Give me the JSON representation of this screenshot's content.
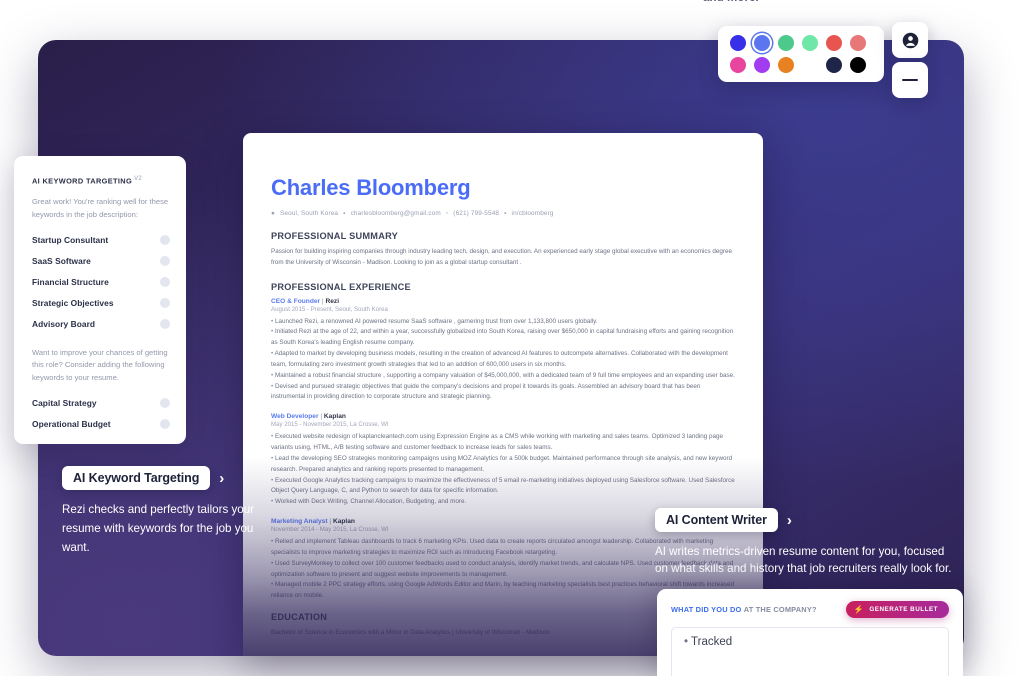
{
  "top_cut_text": "and more.",
  "keyword_panel": {
    "title": "AI KEYWORD TARGETING",
    "version": "v2",
    "description": "Great work! You're ranking well for these keywords in the job description:",
    "matched_keywords": [
      "Startup Consultant",
      "SaaS Software",
      "Financial Structure",
      "Strategic Objectives",
      "Advisory Board"
    ],
    "suggestion_text": "Want to improve your chances of getting this role? Consider adding the following keywords to your resume.",
    "suggested_keywords": [
      "Capital Strategy",
      "Operational Budget"
    ]
  },
  "callouts": [
    {
      "label": "AI Keyword Targeting",
      "chevron": "›",
      "text": "Rezi checks and perfectly tailors your resume with keywords for the job you want."
    },
    {
      "label": "AI Content Writer",
      "chevron": "›",
      "text": "AI writes metrics-driven resume content for you, focused on what skills and history that job recruiters really look for."
    }
  ],
  "resume": {
    "name": "Charles Bloomberg",
    "contact": {
      "location_icon": "pin-icon",
      "location": "Seoul, South Korea",
      "email_icon": "envelope-icon",
      "email": "charlesbloomberg@gmail.com",
      "phone_icon": "phone-icon",
      "phone": "(621) 799-5548",
      "linkedin_icon": "linkedin-icon",
      "linkedin": "in/cbloomberg"
    },
    "sections": [
      {
        "heading": "PROFESSIONAL SUMMARY",
        "paragraph": "Passion for building inspiring companies through industry leading tech, design, and execution. An experienced early stage global executive with an economics degree from the University of Wisconsin - Madison. Looking to join as a global  startup consultant ."
      }
    ],
    "experience_heading": "PROFESSIONAL EXPERIENCE",
    "jobs": [
      {
        "role": "CEO & Founder",
        "separator": "|",
        "company": "Rezi",
        "dates": "August 2015 - Present, Seoul, South Korea",
        "bullets": [
          "Launched Rezi, a renowned AI powered resume  SaaS software , garnering trust from over 1,133,800 users globally.",
          "Initiated Rezi at the age of 22, and within a year, successfully globalized into South Korea, raising over $650,000 in capital fundraising efforts and gaining recognition as South Korea's leading English resume company.",
          "Adapted to market by developing business models, resulting in the creation of advanced AI features to outcompete alternatives. Collaborated with the development team, formulating zero investment growth strategies that led to an addition of 600,000 users in six months.",
          "Maintained a robust  financial structure , supporting a company valuation of $45,000,000, with a dedicated team of 9 full time employees and an expanding user base.",
          "Devised and pursued  strategic objectives  that guide the company's decisions and propel it towards its goals. Assembled an  advisory board  that has been instrumental in providing direction to corporate structure and strategic planning."
        ]
      },
      {
        "role": "Web Developer",
        "separator": "|",
        "company": "Kaplan",
        "dates": "May 2015 - November 2015, La Crosse, WI",
        "bullets": [
          "Executed website redesign of kaplancleantech.com using Expression Engine as a CMS while working with marketing and sales teams. Optimized 3 landing page variants using, HTML, A/B testing software and customer feedback to increase leads for sales teams.",
          "Lead the developing SEO strategies monitoring campaigns using MOZ Analytics for a 500k budget. Maintained performance through site analysis, and new keyword research. Prepared analytics and ranking reports presented to management.",
          "Executed Google Analytics tracking campaigns to maximize the effectiveness of 5 email re-marketing initiatives deployed using Salesforce software. Used Salesforce Object Query Language, C, and Python to search for data for specific information.",
          "Worked with Deck Writing, Channel Allocation, Budgeting, and more."
        ]
      },
      {
        "role": "Marketing Analyst",
        "separator": "|",
        "company": "Kaplan",
        "dates": "November 2014 - May 2015, La Crosse, WI",
        "bullets": [
          "Relied and implement Tableau dashboards to track 6 marketing KPIs. Used data to create reports circulated amongst leadership. Collaborated with marketing specialists to improve marketing strategies to maximize ROI such as introducing Facebook retargeting.",
          "Used SurveyMonkey to collect over 100 customer feedbacks used to conduct analysis, identify market trends, and calculate NPS. Used customer feedback data and optimization software to present and suggest website improvements to management.",
          "Managed mobile 2 PPC strategy efforts, using Google AdWords Editor and Marin, by teaching marketing specialists best practices behavioral shift towards increased reliance on mobile."
        ]
      }
    ],
    "education_heading": "EDUCATION",
    "education_line": "Bachelor of Science in Economics with a Minor in Data Analytics | University of Wisconsin - Madison"
  },
  "bullet_editor": {
    "question_bold": "WHAT DID YOU DO",
    "question_rest": "AT THE COMPANY?",
    "generate_label": "GENERATE BULLET",
    "generate_icon": "lightning-bolt-icon",
    "bullet_value": "Tracked"
  },
  "palette": {
    "row1": [
      "#3730e8",
      "#5b76ee",
      "#4dc98b",
      "#6ee7a8",
      "#e8544f",
      "#e87878"
    ],
    "row2": [
      "#e8459f",
      "#a23cf0",
      "#e8811f",
      "#edа352",
      "#1e2548",
      "#000000"
    ],
    "selected_index": 1
  },
  "buttons": {
    "account_icon": "user-circle-icon",
    "minimize_icon": "minus-icon"
  }
}
